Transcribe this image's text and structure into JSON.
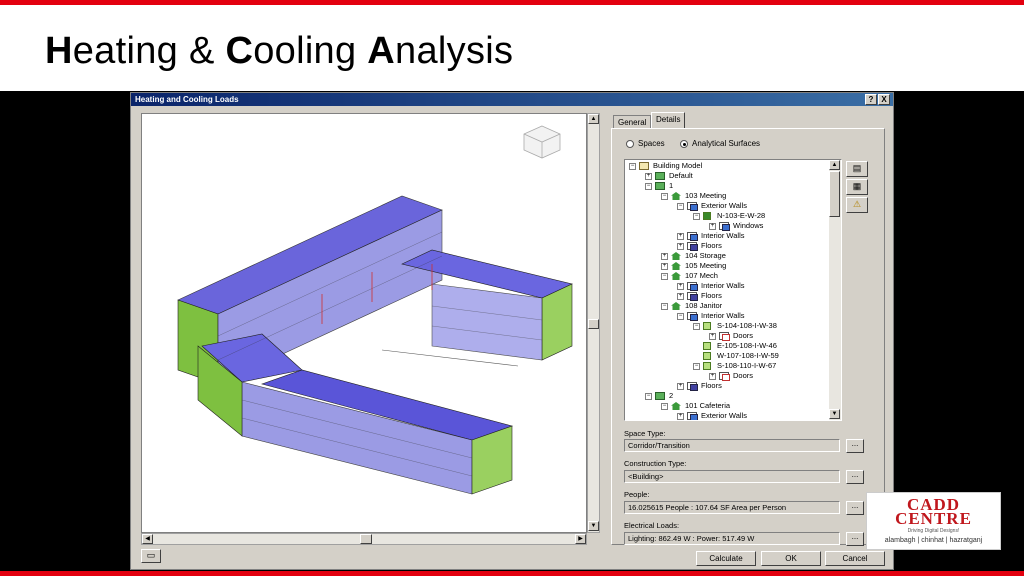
{
  "slide": {
    "title_parts": [
      {
        "bold": "H",
        "rest": "eating & "
      },
      {
        "bold": "C",
        "rest": "ooling "
      },
      {
        "bold": "A",
        "rest": "nalysis"
      }
    ],
    "accent_color": "#e3000f"
  },
  "window": {
    "title": "Heating and Cooling Loads",
    "help_label": "?",
    "close_label": "X"
  },
  "tabs": [
    {
      "label": "General",
      "active": false
    },
    {
      "label": "Details",
      "active": true
    }
  ],
  "radio": {
    "spaces_label": "Spaces",
    "surfaces_label": "Analytical Surfaces",
    "selected": "Analytical Surfaces"
  },
  "tree": [
    {
      "label": "Building Model",
      "depth": 0,
      "exp": "−",
      "icon": "folder"
    },
    {
      "label": "Default",
      "depth": 1,
      "exp": "+",
      "icon": "level"
    },
    {
      "label": "1",
      "depth": 1,
      "exp": "−",
      "icon": "level"
    },
    {
      "label": "103 Meeting",
      "depth": 2,
      "exp": "−",
      "icon": "house"
    },
    {
      "label": "Exterior Walls",
      "depth": 3,
      "exp": "−",
      "icon": "wall"
    },
    {
      "label": "N-103-E-W-28",
      "depth": 4,
      "exp": "−",
      "icon": "surf dark"
    },
    {
      "label": "Windows",
      "depth": 5,
      "exp": "+",
      "icon": "wall"
    },
    {
      "label": "Interior Walls",
      "depth": 3,
      "exp": "+",
      "icon": "wall"
    },
    {
      "label": "Floors",
      "depth": 3,
      "exp": "+",
      "icon": "floor"
    },
    {
      "label": "104 Storage",
      "depth": 2,
      "exp": "+",
      "icon": "house"
    },
    {
      "label": "105 Meeting",
      "depth": 2,
      "exp": "+",
      "icon": "house"
    },
    {
      "label": "107 Mech",
      "depth": 2,
      "exp": "−",
      "icon": "house"
    },
    {
      "label": "Interior Walls",
      "depth": 3,
      "exp": "+",
      "icon": "wall"
    },
    {
      "label": "Floors",
      "depth": 3,
      "exp": "+",
      "icon": "floor"
    },
    {
      "label": "108 Janitor",
      "depth": 2,
      "exp": "−",
      "icon": "house"
    },
    {
      "label": "Interior Walls",
      "depth": 3,
      "exp": "−",
      "icon": "wall"
    },
    {
      "label": "S-104-108-I-W-38",
      "depth": 4,
      "exp": "−",
      "icon": "surf"
    },
    {
      "label": "Doors",
      "depth": 5,
      "exp": "+",
      "icon": "door"
    },
    {
      "label": "E-105-108-I-W-46",
      "depth": 4,
      "exp": "",
      "icon": "surf"
    },
    {
      "label": "W-107-108-I-W-59",
      "depth": 4,
      "exp": "",
      "icon": "surf"
    },
    {
      "label": "S-108-110-I-W-67",
      "depth": 4,
      "exp": "−",
      "icon": "surf"
    },
    {
      "label": "Doors",
      "depth": 5,
      "exp": "+",
      "icon": "door"
    },
    {
      "label": "Floors",
      "depth": 3,
      "exp": "+",
      "icon": "floor"
    },
    {
      "label": "2",
      "depth": 1,
      "exp": "−",
      "icon": "level"
    },
    {
      "label": "101 Cafeteria",
      "depth": 2,
      "exp": "−",
      "icon": "house"
    },
    {
      "label": "Exterior Walls",
      "depth": 3,
      "exp": "+",
      "icon": "wall"
    }
  ],
  "side_buttons": [
    "table-icon",
    "report-icon",
    "warning-icon"
  ],
  "fields": {
    "space_type_label": "Space Type:",
    "space_type_value": "Corridor/Transition",
    "construction_type_label": "Construction Type:",
    "construction_type_value": "<Building>",
    "people_label": "People:",
    "people_value": "16.025615 People : 107.64 SF Area per Person",
    "electrical_label": "Electrical Loads:",
    "electrical_value": "Lighting: 862.49 W : Power: 517.49 W",
    "dots_label": "..."
  },
  "buttons": {
    "calculate": "Calculate",
    "ok": "OK",
    "cancel": "Cancel"
  },
  "logo": {
    "line1": "CADD",
    "line2": "CENTRE",
    "tagline": "Driving Digital Designs!",
    "branches": "alambagh | chinhat | hazratganj"
  }
}
